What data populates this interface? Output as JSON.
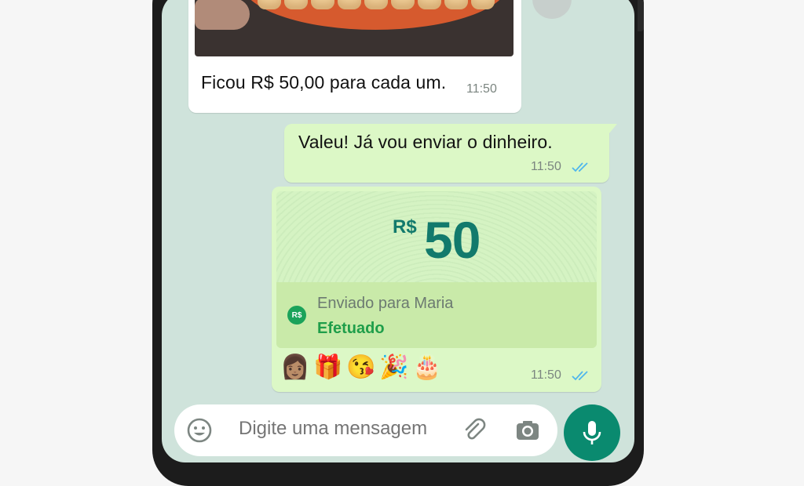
{
  "chat": {
    "incoming": {
      "text": "Ficou R$ 50,00 para cada um.",
      "time": "11:50"
    },
    "outgoing": {
      "text": "Valeu! Já vou enviar o dinheiro.",
      "time": "11:50",
      "status_icon": "double-check-icon"
    },
    "payment": {
      "currency": "R$",
      "amount": "50",
      "badge": "R$",
      "recipient_line": "Enviado para Maria",
      "status": "Efetuado",
      "emojis": [
        "👩🏽",
        "🎁",
        "😘",
        "🎉",
        "🎂"
      ],
      "time": "11:50",
      "status_icon": "double-check-icon"
    }
  },
  "composer": {
    "placeholder": "Digite uma mensagem",
    "emoji_icon": "smiley-icon",
    "attach_icon": "paperclip-icon",
    "camera_icon": "camera-icon",
    "mic_icon": "microphone-icon"
  },
  "colors": {
    "chat_background": "#cfe3db",
    "outgoing_bubble": "#dcf8c6",
    "accent_green": "#127a6c",
    "status_green": "#1f9e4a",
    "read_ticks": "#4fb6ec",
    "mic_button": "#0a8a6f"
  }
}
